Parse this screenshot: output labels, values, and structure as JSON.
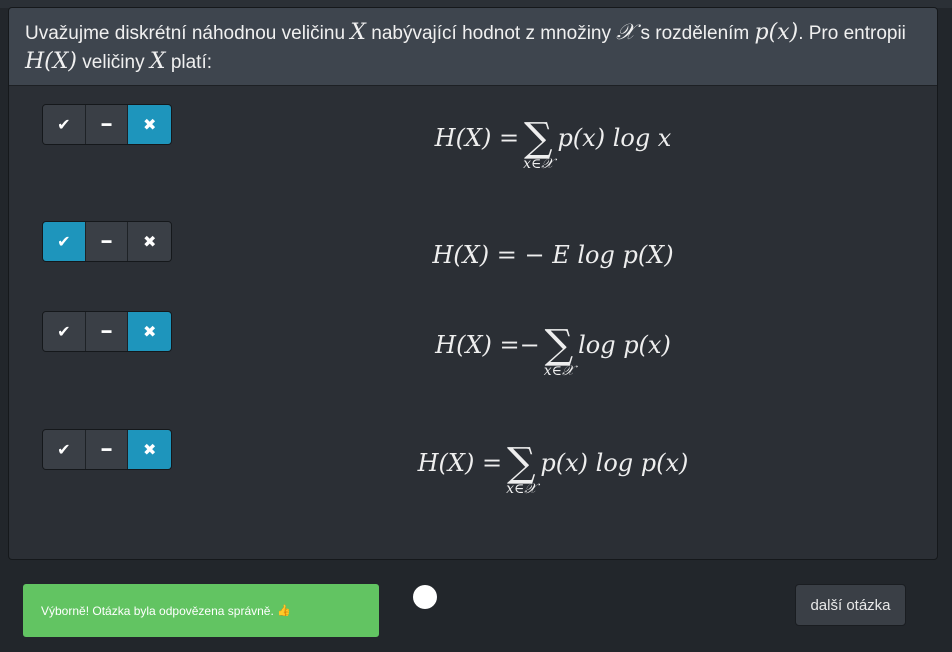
{
  "question": {
    "text_1": "Uvažujme diskrétní náhodnou veličinu ",
    "var_X": "X",
    "text_2": " nabývající hodnot z množiny ",
    "set_X": "𝒳",
    "text_3": " s rozdělením ",
    "px": "p(x)",
    "text_4": ". Pro entropii ",
    "HX": "H(X)",
    "text_5": " veličiny ",
    "text_6": " platí:"
  },
  "toggle_icons": {
    "true": "✔",
    "neutral": "━",
    "false": "✖"
  },
  "options": [
    {
      "selected": "false",
      "lhs": "H(X) = ",
      "prefix": "",
      "sum": "∑",
      "sub": "x∈𝒳",
      "body": "p(x) log x"
    },
    {
      "selected": "true",
      "lhs": "H(X) = − E log p(X)",
      "prefix": "",
      "sum": "",
      "sub": "",
      "body": ""
    },
    {
      "selected": "false",
      "lhs": "H(X) = ",
      "prefix": "−",
      "sum": "∑",
      "sub": "x∈𝒳",
      "body": "log p(x)"
    },
    {
      "selected": "false",
      "lhs": "H(X) = ",
      "prefix": "",
      "sum": "∑",
      "sub": "x∈𝒳",
      "body": "p(x) log p(x)"
    }
  ],
  "feedback": {
    "text": "Výborně! Otázka byla odpovězena správně.",
    "icon": "👍"
  },
  "next_button": "další otázka",
  "colors": {
    "active_toggle": "#1e95bc",
    "success": "#62c462"
  }
}
